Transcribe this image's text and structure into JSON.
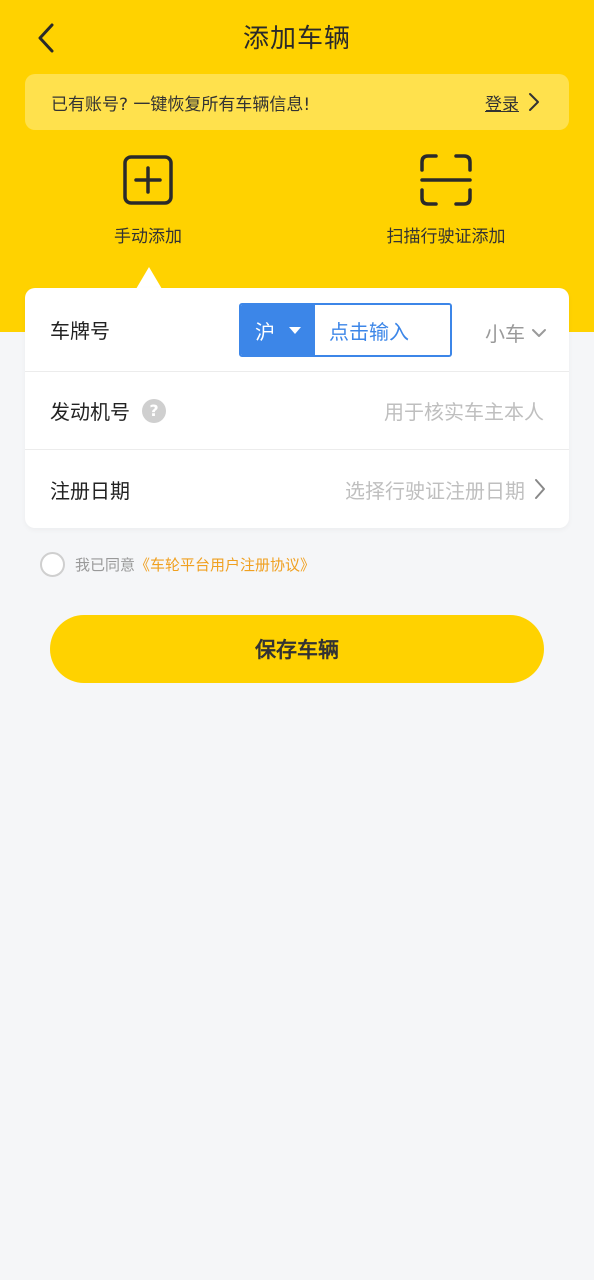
{
  "header": {
    "title": "添加车辆",
    "back_icon": "chevron-left-icon"
  },
  "banner": {
    "text": "已有账号? 一键恢复所有车辆信息!",
    "login_label": "登录",
    "login_icon": "chevron-right-icon"
  },
  "modes": [
    {
      "label": "手动添加",
      "icon": "plus-square-icon",
      "selected": true
    },
    {
      "label": "扫描行驶证添加",
      "icon": "scan-frame-icon",
      "selected": false
    }
  ],
  "form": {
    "plate": {
      "label": "车牌号",
      "province": "沪",
      "input_placeholder": "点击输入",
      "car_type": "小车"
    },
    "engine": {
      "label": "发动机号",
      "placeholder": "用于核实车主本人",
      "help_icon": "question-circle-icon"
    },
    "register_date": {
      "label": "注册日期",
      "placeholder": "选择行驶证注册日期"
    }
  },
  "agreement": {
    "prefix": "我已同意",
    "link": "《车轮平台用户注册协议》",
    "checked": false
  },
  "save_button": "保存车辆",
  "colors": {
    "brand_yellow": "#ffd200",
    "accent_blue": "#3c86e8",
    "link_orange": "#f0a020"
  }
}
